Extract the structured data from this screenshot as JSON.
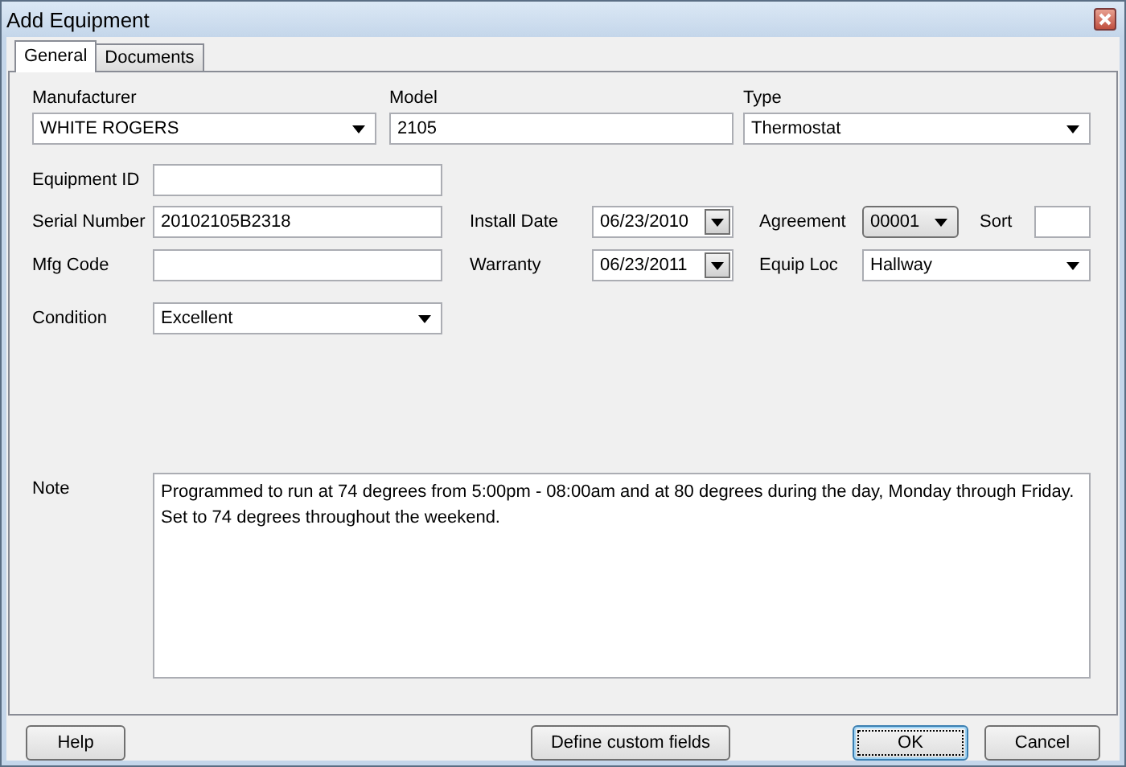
{
  "window": {
    "title": "Add Equipment"
  },
  "tabs": [
    {
      "label": "General",
      "selected": true
    },
    {
      "label": "Documents",
      "selected": false
    }
  ],
  "manufacturer": {
    "label": "Manufacturer",
    "value": "WHITE ROGERS"
  },
  "model": {
    "label": "Model",
    "value": "2105"
  },
  "type": {
    "label": "Type",
    "value": "Thermostat"
  },
  "equipment_id": {
    "label": "Equipment ID"
  },
  "serial_number": {
    "label": "Serial Number",
    "value": "20102105B2318"
  },
  "install_date": {
    "label": "Install Date",
    "value": "06/23/2010"
  },
  "agreement": {
    "label": "Agreement",
    "value": "00001"
  },
  "sort": {
    "label": "Sort"
  },
  "mfg_code": {
    "label": "Mfg Code"
  },
  "warranty": {
    "label": "Warranty",
    "value": "06/23/2011"
  },
  "equip_loc": {
    "label": "Equip Loc",
    "value": "Hallway"
  },
  "condition": {
    "label": "Condition",
    "value": "Excellent"
  },
  "note": {
    "label": "Note",
    "value": "Programmed to run at 74 degrees from 5:00pm - 08:00am and at 80 degrees during the day, Monday through Friday. Set to 74 degrees throughout the weekend."
  },
  "buttons": [
    {
      "label": "Help",
      "default": false
    },
    {
      "label": "Define custom fields",
      "default": false
    },
    {
      "label": "OK",
      "default": true
    },
    {
      "label": "Cancel",
      "default": false
    }
  ]
}
